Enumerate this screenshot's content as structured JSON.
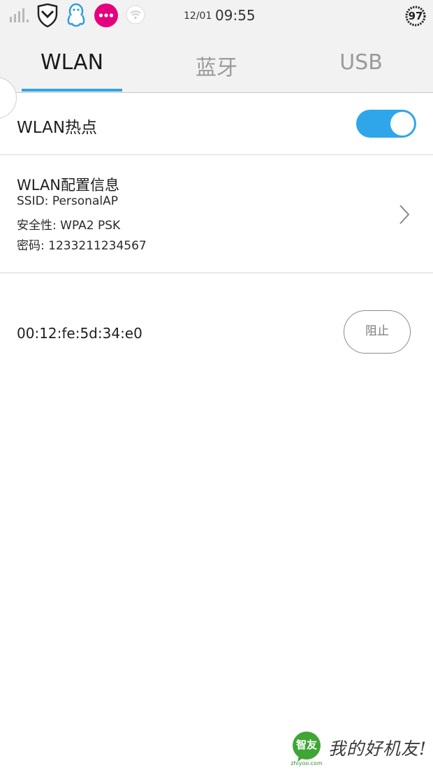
{
  "status_bar": {
    "date": "12/01",
    "time": "09:55",
    "battery": "97",
    "icons": [
      "signal-icon",
      "shield-icon",
      "qq-penguin-icon",
      "more-bubble-icon",
      "wifi-icon"
    ]
  },
  "tabs": [
    {
      "label": "WLAN",
      "active": true
    },
    {
      "label": "蓝牙",
      "active": false
    },
    {
      "label": "USB",
      "active": false
    }
  ],
  "hotspot": {
    "label": "WLAN热点",
    "enabled": true
  },
  "config": {
    "title": "WLAN配置信息",
    "ssid": "SSID: PersonalAP",
    "security": "安全性: WPA2 PSK",
    "password": "密码: 1233211234567"
  },
  "connected_device": {
    "mac": "00:12:fe:5d:34:e0",
    "block_label": "阻止"
  },
  "watermark": {
    "logo_text": "智友",
    "domain": "zhiyoo.com",
    "slogan": "我的好机友!"
  },
  "colors": {
    "accent": "#33a3e6",
    "toggle_on": "#2fa6ea",
    "pink_icon": "#e5007e",
    "watermark_green": "#3fa535"
  }
}
